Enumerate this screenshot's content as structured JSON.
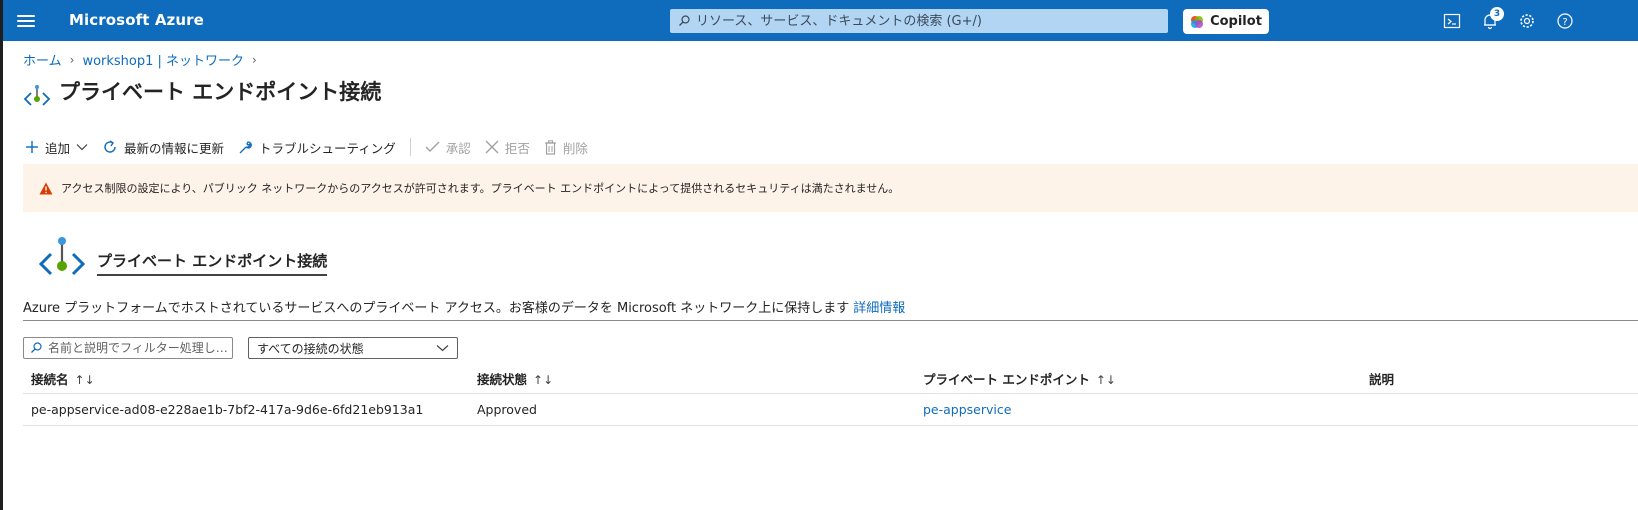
{
  "topbar": {
    "brand": "Microsoft Azure",
    "search_placeholder": "リソース、サービス、ドキュメントの検索 (G+/)",
    "copilot_label": "Copilot",
    "notification_count": "3",
    "accent_color": "#0f6cbd"
  },
  "breadcrumb": {
    "items": [
      "ホーム",
      "workshop1 | ネットワーク"
    ]
  },
  "page": {
    "title": "プライベート エンドポイント接続",
    "more": "···"
  },
  "toolbar": {
    "add_label": "追加",
    "refresh_label": "最新の情報に更新",
    "troubleshoot_label": "トラブルシューティング",
    "approve_label": "承認",
    "reject_label": "拒否",
    "delete_label": "削除"
  },
  "warning": {
    "text": "アクセス制限の設定により、パブリック ネットワークからのアクセスが許可されます。プライベート エンドポイントによって提供されるセキュリティは満たされません。",
    "icon": "warning-icon",
    "color": "#fdf3e9"
  },
  "section": {
    "title": "プライベート エンドポイント接続",
    "description": "Azure プラットフォームでホストされているサービスへのプライベート アクセス。お客様のデータを Microsoft ネットワーク上に保持します",
    "learn_more": "詳細情報"
  },
  "filters": {
    "search_placeholder": "名前と説明でフィルター処理し…",
    "status_value": "すべての接続の状態"
  },
  "table": {
    "columns": [
      "接続名",
      "接続状態",
      "プライベート エンドポイント",
      "説明"
    ],
    "rows": [
      {
        "name": "pe-appservice-ad08-e228ae1b-7bf2-417a-9d6e-6fd21eb913a1",
        "status": "Approved",
        "endpoint": "pe-appservice",
        "description": ""
      }
    ]
  }
}
